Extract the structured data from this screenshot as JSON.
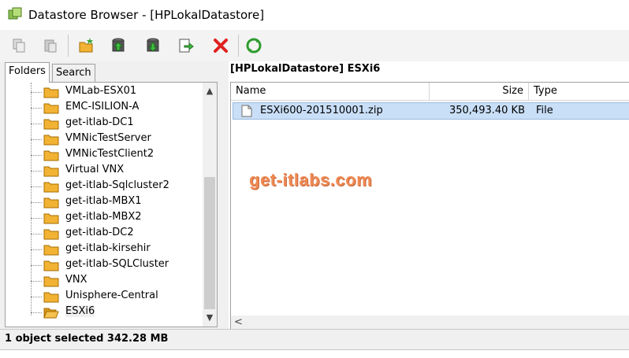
{
  "window": {
    "title": "Datastore Browser - [HPLokalDatastore]"
  },
  "toolbar": {
    "buttons": [
      "copy-icon",
      "paste-icon",
      "new-folder-icon",
      "upload-icon",
      "download-icon",
      "move-icon",
      "delete-icon",
      "refresh-icon"
    ]
  },
  "tabs": [
    {
      "label": "Folders",
      "active": true
    },
    {
      "label": "Search",
      "active": false
    }
  ],
  "tree": {
    "items": [
      {
        "label": "VMLab-ESX01"
      },
      {
        "label": "EMC-ISILION-A"
      },
      {
        "label": "get-itlab-DC1"
      },
      {
        "label": "VMNicTestServer"
      },
      {
        "label": "VMNicTestClient2"
      },
      {
        "label": "Virtual VNX"
      },
      {
        "label": "get-itlab-Sqlcluster2"
      },
      {
        "label": "get-itlab-MBX1"
      },
      {
        "label": "get-itlab-MBX2"
      },
      {
        "label": "get-itlab-DC2"
      },
      {
        "label": "get-itlab-kirsehir"
      },
      {
        "label": "get-itlab-SQLCluster"
      },
      {
        "label": "VNX"
      },
      {
        "label": "Unisphere-Central"
      },
      {
        "label": "ESXi6",
        "open": true
      }
    ]
  },
  "content": {
    "path_title": "[HPLokalDatastore] ESXi6",
    "columns": {
      "name": "Name",
      "size": "Size",
      "type": "Type"
    },
    "rows": [
      {
        "name": "ESXi600-201510001.zip",
        "size": "350,493.40 KB",
        "type": "File"
      }
    ]
  },
  "watermark": "get-itlabs.com",
  "status": {
    "text": "1 object selected 342.28 MB"
  },
  "colors": {
    "selection": "#c9dff7",
    "watermark": "#ef8a54",
    "delete": "#e02020",
    "refresh": "#2e9b2e",
    "folder": "#f2b233"
  }
}
